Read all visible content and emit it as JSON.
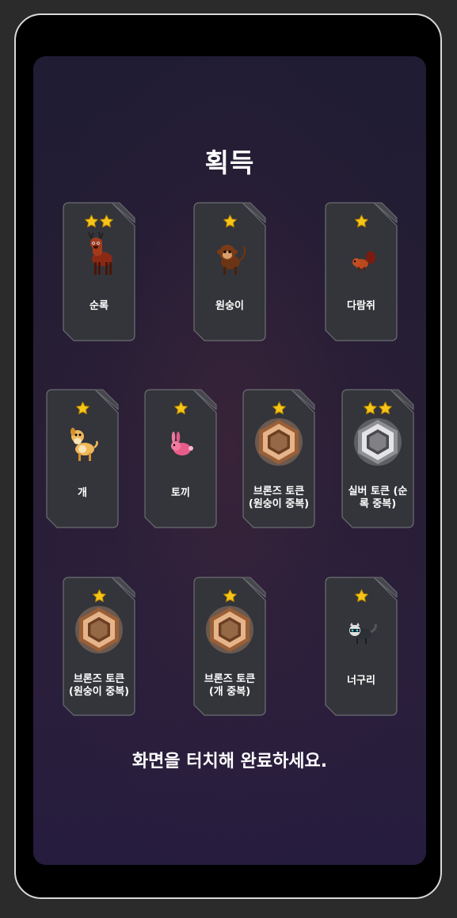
{
  "title": "획득",
  "footer_text": "화면을 터치해 완료하세요.",
  "cards": [
    {
      "label": "순록",
      "stars": 2,
      "icon": "reindeer-icon"
    },
    {
      "label": "원숭이",
      "stars": 1,
      "icon": "monkey-icon"
    },
    {
      "label": "다람쥐",
      "stars": 1,
      "icon": "squirrel-icon"
    },
    {
      "label": "개",
      "stars": 1,
      "icon": "dog-icon"
    },
    {
      "label": "토끼",
      "stars": 1,
      "icon": "rabbit-icon"
    },
    {
      "label": "브론즈 토큰\n(원숭이 중복)",
      "stars": 1,
      "icon": "bronze-token-icon"
    },
    {
      "label": "실버 토큰 (순\n록 중복)",
      "stars": 2,
      "icon": "silver-token-icon"
    },
    {
      "label": "브론즈 토큰\n(원숭이 중복)",
      "stars": 1,
      "icon": "bronze-token-icon"
    },
    {
      "label": "브론즈 토큰\n(개 중복)",
      "stars": 1,
      "icon": "bronze-token-icon"
    },
    {
      "label": "너구리",
      "stars": 1,
      "icon": "raccoon-icon"
    }
  ],
  "colors": {
    "card_bg": "#33353a",
    "card_border": "#6c6e73",
    "star": "#f5c518",
    "bronze": "#c98a58",
    "silver": "#c9c9cc"
  }
}
